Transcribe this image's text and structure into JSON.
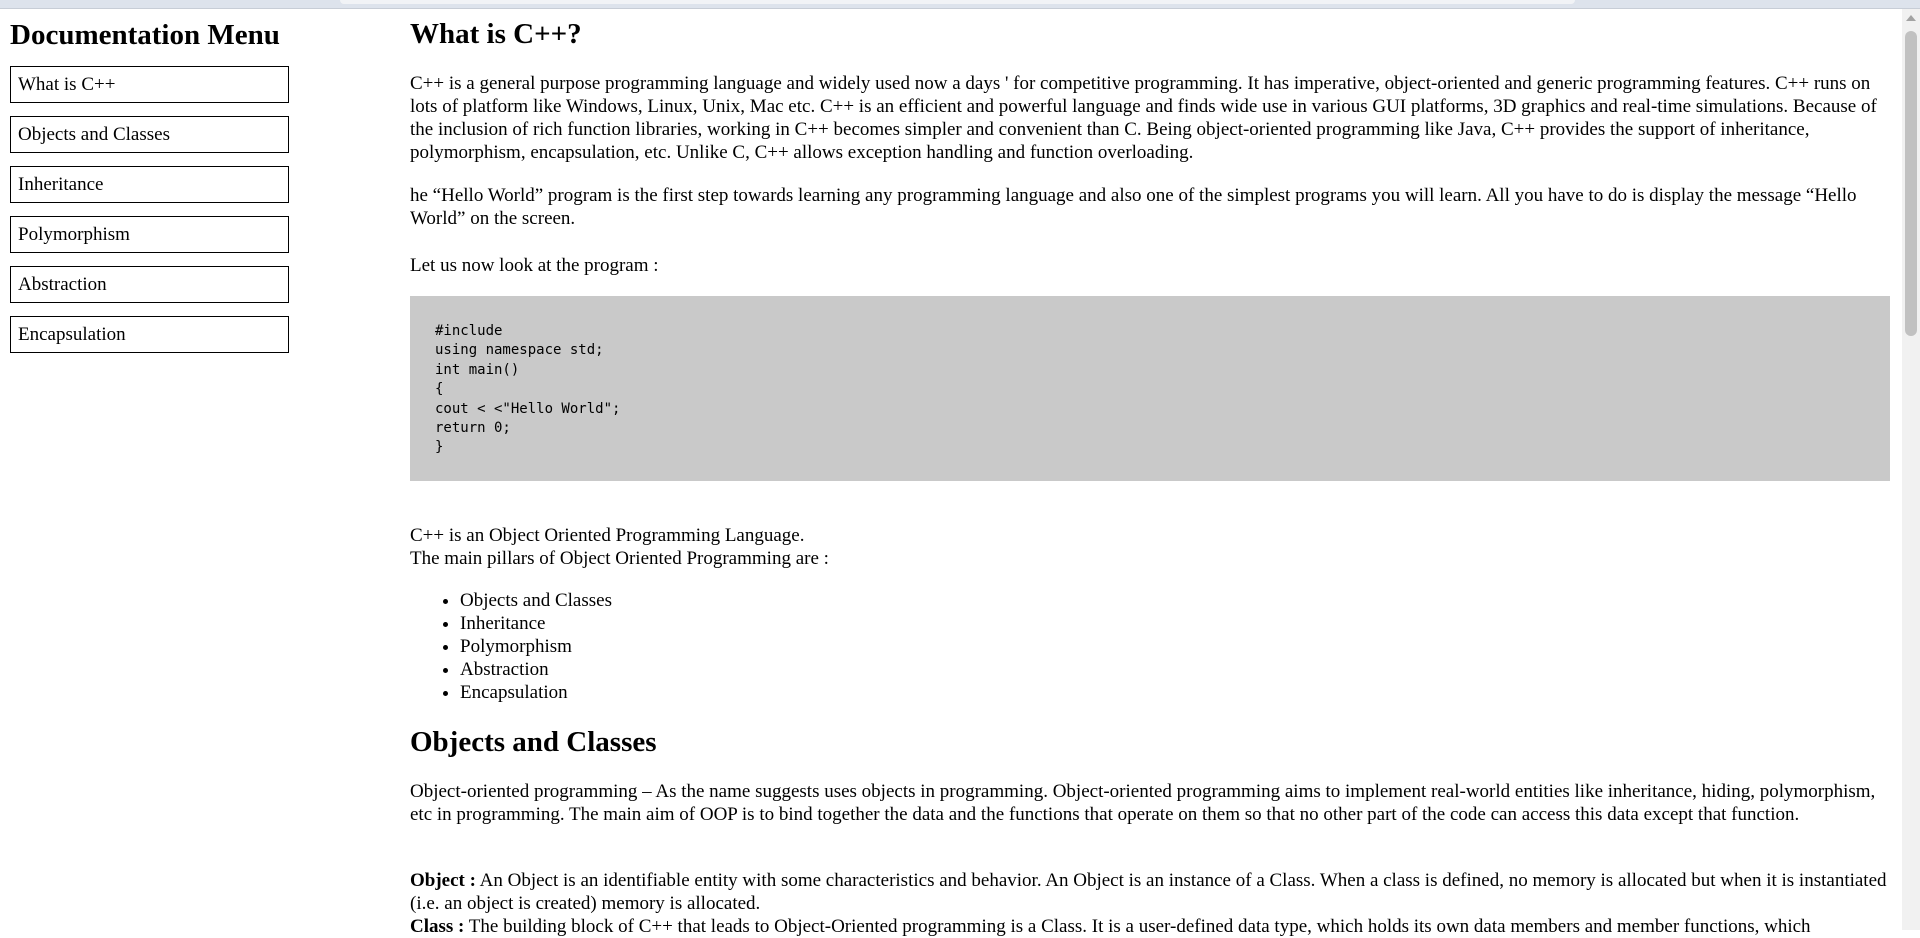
{
  "nav": {
    "header": "Documentation Menu",
    "links": [
      "What is C++",
      "Objects and Classes",
      "Inheritance",
      "Polymorphism",
      "Abstraction",
      "Encapsulation"
    ]
  },
  "main": {
    "section1": {
      "title": "What is C++?",
      "p1": "C++ is a general purpose programming language and widely used now a days ' for competitive programming. It has imperative, object-oriented and generic programming features. C++ runs on lots of platform like Windows, Linux, Unix, Mac etc. C++ is an efficient and powerful language and finds wide use in various GUI platforms, 3D graphics and real-time simulations. Because of the inclusion of rich function libraries, working in C++ becomes simpler and convenient than C. Being object-oriented programming like Java, C++ provides the support of inheritance, polymorphism, encapsulation, etc. Unlike C, C++ allows exception handling and function overloading.",
      "p2": "he “Hello World” program is the first step towards learning any programming language and also one of the simplest programs you will learn. All you have to do is display the message “Hello World” on the screen.",
      "p3": "Let us now look at the program :",
      "code": "#include\nusing namespace std;\nint main()\n{\ncout < <\"Hello World\";\nreturn 0;\n}",
      "p4_line1": "C++ is an Object Oriented Programming Language.",
      "p4_line2": "The main pillars of Object Oriented Programming are :",
      "pillars": [
        "Objects and Classes",
        "Inheritance",
        "Polymorphism",
        "Abstraction",
        "Encapsulation"
      ]
    },
    "section2": {
      "title": "Objects and Classes",
      "p1": "Object-oriented programming – As the name suggests uses objects in programming. Object-oriented programming aims to implement real-world entities like inheritance, hiding, polymorphism, etc in programming. The main aim of OOP is to bind together the data and the functions that operate on them so that no other part of the code can access this data except that function.",
      "object_label": "Object :",
      "object_text": " An Object is an identifiable entity with some characteristics and behavior. An Object is an instance of a Class. When a class is defined, no memory is allocated but when it is instantiated (i.e. an object is created) memory is allocated.",
      "class_label": "Class :",
      "class_text": " The building block of C++ that leads to Object-Oriented programming is a Class. It is a user-defined data type, which holds its own data members and member functions, which"
    }
  }
}
